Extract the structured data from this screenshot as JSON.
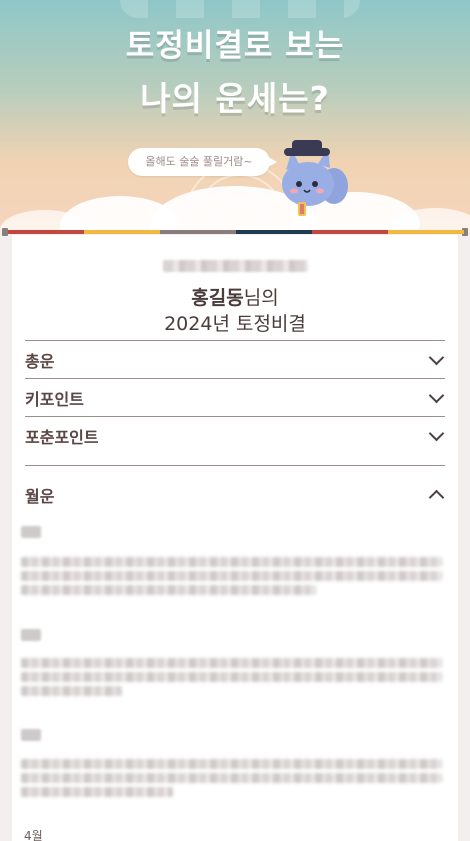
{
  "hero": {
    "title_line1": "토정비결로 보는",
    "title_line2": "나의 운세는?",
    "bubble_text": "올해도 술술 풀릴거람~"
  },
  "stripe_colors": [
    "#c4473f",
    "#f1b843",
    "#8a7c7a",
    "#1f3b4f",
    "#c4473f",
    "#f1b843"
  ],
  "profile": {
    "name": "홍길동",
    "name_suffix": "님의",
    "subtitle": "2024년 토정비결"
  },
  "sections": [
    {
      "label": "총운",
      "expanded": false
    },
    {
      "label": "키포인트",
      "expanded": false
    },
    {
      "label": "포춘포인트",
      "expanded": false
    },
    {
      "label": "월운",
      "expanded": true
    }
  ],
  "monthly": {
    "visible_month_label": "4월"
  }
}
